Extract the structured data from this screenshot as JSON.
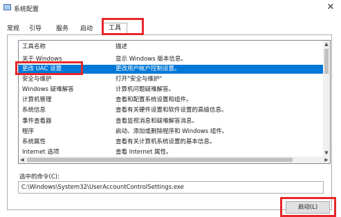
{
  "window": {
    "title": "系统配置",
    "close_glyph": "✕",
    "icon": "msconfig-icon"
  },
  "tabs": [
    {
      "label": "常规"
    },
    {
      "label": "引导"
    },
    {
      "label": "服务"
    },
    {
      "label": "启动"
    },
    {
      "label": "工具",
      "active": true
    }
  ],
  "tools_list": {
    "columns": [
      "工具名称",
      "描述"
    ],
    "rows": [
      [
        "关于 Windows",
        "显示 Windows 版本信息。"
      ],
      [
        "更改 UAC 设置",
        "更改用户帐户控制设置。"
      ],
      [
        "安全与维护",
        "打开\"安全与维护\""
      ],
      [
        "Windows 疑难解答",
        "计算机问题疑难解答。"
      ],
      [
        "计算机管理",
        "查看和配置系统设置和组件。"
      ],
      [
        "系统信息",
        "查看有关硬件设置和软件设置的高级信息。"
      ],
      [
        "事件查看器",
        "查看监视消息和疑难解答消息。"
      ],
      [
        "程序",
        "启动、添加或删除程序和 Windows 组件。"
      ],
      [
        "系统属性",
        "查看有关计算机系统设置的基本信息。"
      ],
      [
        "Internet 选项",
        "查看 Internet 属性。"
      ]
    ],
    "selected_index": 1
  },
  "command": {
    "label": "选中的命令(C):",
    "value": "C:\\Windows\\System32\\UserAccountControlSettings.exe"
  },
  "launch_button": {
    "label": "启动(L)"
  },
  "colors": {
    "selection": "#0078d7",
    "highlight": "#e8262a"
  }
}
